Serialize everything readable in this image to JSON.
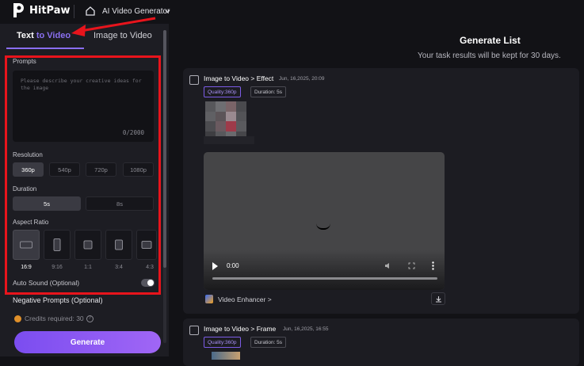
{
  "header": {
    "brand": "HitPaw",
    "app_name": "AI Video Generator"
  },
  "sidebar": {
    "tabs": [
      {
        "label_a": "Text ",
        "label_b": "to Video"
      },
      {
        "label": "Image to Video"
      }
    ],
    "prompts_label": "Prompts",
    "prompt_placeholder": "Please describe your creative ideas for the image",
    "prompt_count": "0/2000",
    "resolution_label": "Resolution",
    "resolutions": [
      "360p",
      "540p",
      "720p",
      "1080p"
    ],
    "resolution_selected": "360p",
    "duration_label": "Duration",
    "durations": [
      "5s",
      "8s"
    ],
    "aspect_label": "Aspect Ratio",
    "aspects": [
      "16:9",
      "9:16",
      "1:1",
      "3:4",
      "4:3"
    ],
    "auto_sound_label": "Auto Sound (Optional)",
    "negative_label": "Negative Prompts (Optional)",
    "credits": "Credits required: 30",
    "generate_label": "Generate"
  },
  "main": {
    "title": "Generate List",
    "subtitle": "Your task results will be kept for 30 days.",
    "tasks": [
      {
        "title": "Image to Video > Effect",
        "date": "Jun, 16,2025, 20:09",
        "quality": "Quality:360p",
        "duration": "Duration: 5s",
        "video_time": "0:00",
        "enhancer": "Video Enhancer >"
      },
      {
        "title": "Image to Video > Frame",
        "date": "Jun, 16,2025, 16:55",
        "quality": "Quality:360p",
        "duration": "Duration: 5s"
      }
    ]
  },
  "colors": {
    "accent": "#8a6ef5",
    "annotation_red": "#e8141c"
  }
}
